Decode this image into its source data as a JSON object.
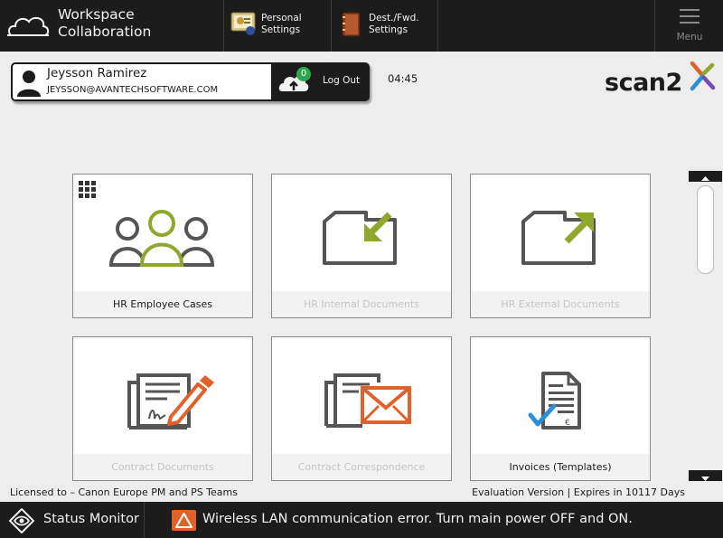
{
  "header": {
    "app_title": "Workspace\nCollaboration",
    "personal_settings": "Personal\nSettings",
    "dest_settings": "Dest./Fwd.\nSettings",
    "menu": "Menu"
  },
  "user": {
    "name": "Jeysson Ramirez",
    "email": "JEYSSON@AVANTECHSOFTWARE.COM",
    "badge_count": "0",
    "logout": "Log Out"
  },
  "clock": "04:45",
  "logo_text": "scan2x",
  "tiles": [
    {
      "label": "HR Employee Cases",
      "enabled": true,
      "icon": "people-icon"
    },
    {
      "label": "HR Internal Documents",
      "enabled": false,
      "icon": "folder-in-icon"
    },
    {
      "label": "HR External Documents",
      "enabled": false,
      "icon": "folder-out-icon"
    },
    {
      "label": "Contract Documents",
      "enabled": false,
      "icon": "contract-sign-icon"
    },
    {
      "label": "Contract Correspondence",
      "enabled": false,
      "icon": "envelope-icon"
    },
    {
      "label": "Invoices (Templates)",
      "enabled": true,
      "icon": "invoice-check-icon"
    }
  ],
  "footer": {
    "licensed": "Licensed to – Canon Europe PM and PS Teams",
    "evaluation": "Evaluation Version | Expires in 10117 Days"
  },
  "status": {
    "monitor": "Status Monitor",
    "message": "Wireless LAN communication error. Turn main power OFF and ON."
  },
  "colors": {
    "accent_green": "#8da82c",
    "accent_orange": "#e0622a",
    "check_blue": "#2a8fd4",
    "icon_gray": "#555555",
    "bar_dark": "#1c1c1c"
  }
}
